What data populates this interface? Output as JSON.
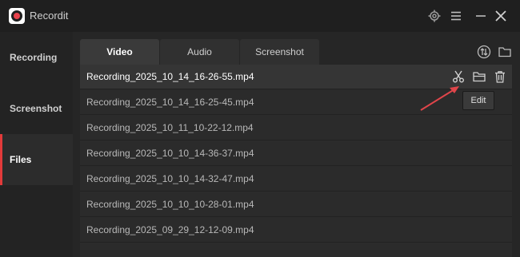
{
  "app": {
    "title": "Recordit"
  },
  "titlebar": {
    "icons": [
      "gear-icon",
      "menu-icon",
      "minimize-icon",
      "close-icon"
    ]
  },
  "sidebar": {
    "items": [
      {
        "label": "Recording"
      },
      {
        "label": "Screenshot"
      },
      {
        "label": "Files",
        "active": true
      }
    ]
  },
  "tabs": [
    {
      "label": "Video",
      "active": true
    },
    {
      "label": "Audio"
    },
    {
      "label": "Screenshot"
    }
  ],
  "toolbar_icons": [
    "sort-icon",
    "folder-icon"
  ],
  "files": [
    {
      "name": "Recording_2025_10_14_16-26-55.mp4",
      "selected": true
    },
    {
      "name": "Recording_2025_10_14_16-25-45.mp4"
    },
    {
      "name": "Recording_2025_10_11_10-22-12.mp4"
    },
    {
      "name": "Recording_2025_10_10_14-36-37.mp4"
    },
    {
      "name": "Recording_2025_10_10_14-32-47.mp4"
    },
    {
      "name": "Recording_2025_10_10_10-28-01.mp4"
    },
    {
      "name": "Recording_2025_09_29_12-12-09.mp4"
    }
  ],
  "row_actions": [
    "scissors-icon",
    "open-folder-icon",
    "trash-icon"
  ],
  "tooltip": {
    "text": "Edit"
  },
  "colors": {
    "accent": "#e23a3a",
    "annotation_arrow": "#e0454a"
  }
}
